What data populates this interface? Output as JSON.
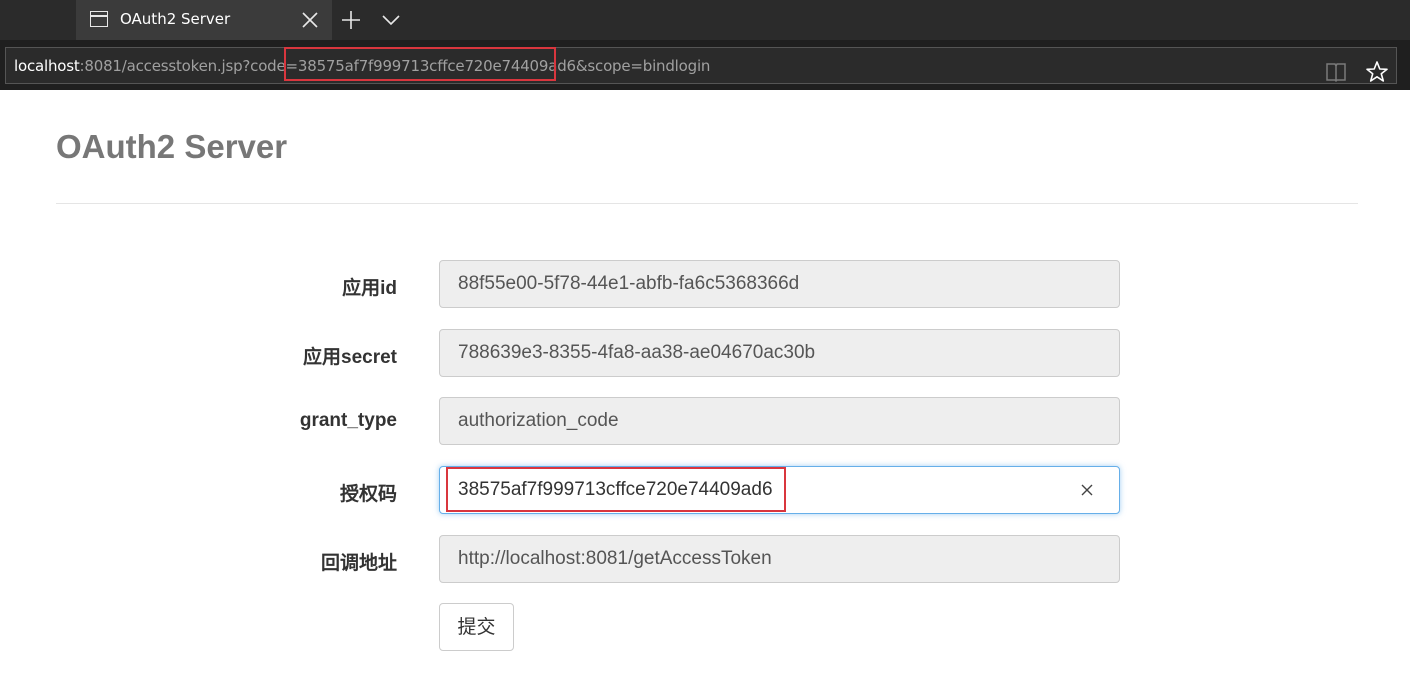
{
  "browser": {
    "tab": {
      "title": "OAuth2 Server"
    },
    "address": {
      "host": "localhost",
      "url_rest_before_code": ":8081/accesstoken.jsp?code=",
      "code": "38575af7f999713cffce720e74409ad6",
      "url_rest_after_code": "&scope=bindlogin"
    },
    "icons": [
      "tab-page-icon",
      "close-icon",
      "plus-icon",
      "chevron-down-icon",
      "reading-view-icon",
      "star-icon"
    ]
  },
  "page": {
    "title": "OAuth2 Server"
  },
  "form": {
    "fields": [
      {
        "label": "应用id",
        "value": "88f55e00-5f78-44e1-abfb-fa6c5368366d",
        "readonly": true
      },
      {
        "label": "应用secret",
        "value": "788639e3-8355-4fa8-aa38-ae04670ac30b",
        "readonly": true
      },
      {
        "label": "grant_type",
        "value": "authorization_code",
        "readonly": true
      },
      {
        "label": "授权码",
        "value": "38575af7f999713cffce720e74409ad6",
        "readonly": false
      },
      {
        "label": "回调地址",
        "value": "http://localhost:8081/getAccessToken",
        "readonly": true
      }
    ],
    "submit_label": "提交"
  },
  "colors": {
    "highlight_box": "#d9363e",
    "focus_border": "#66afe9",
    "readonly_bg": "#eeeeee"
  }
}
